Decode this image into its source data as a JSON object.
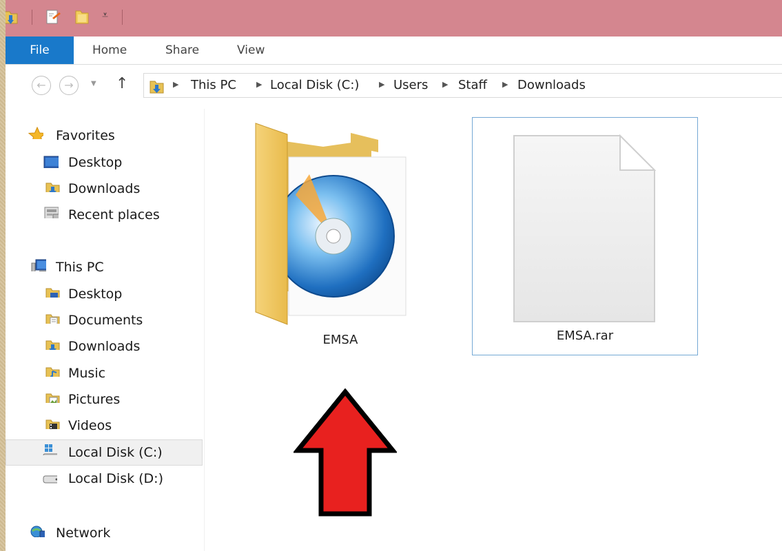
{
  "ribbon": {
    "tabs": [
      {
        "label": "File",
        "active": true
      },
      {
        "label": "Home"
      },
      {
        "label": "Share"
      },
      {
        "label": "View"
      }
    ]
  },
  "address": {
    "crumbs": [
      "This PC",
      "Local Disk (C:)",
      "Users",
      "Staff",
      "Downloads"
    ]
  },
  "nav": {
    "favorites": {
      "label": "Favorites",
      "items": [
        "Desktop",
        "Downloads",
        "Recent places"
      ]
    },
    "this_pc": {
      "label": "This PC",
      "items": [
        "Desktop",
        "Documents",
        "Downloads",
        "Music",
        "Pictures",
        "Videos",
        "Local Disk (C:)",
        "Local Disk (D:)"
      ]
    },
    "network": {
      "label": "Network"
    },
    "selected_item": "Local Disk (C:)"
  },
  "files": [
    {
      "name": "EMSA",
      "type": "folder",
      "icon": "disc-folder-icon"
    },
    {
      "name": "EMSA.rar",
      "type": "file",
      "icon": "blank-file-icon",
      "selected": true
    }
  ],
  "colors": {
    "titlebar": "#d4868f",
    "file_tab": "#1979ca",
    "selection_border": "#74a8d5",
    "arrow_fill": "#e8211f"
  }
}
